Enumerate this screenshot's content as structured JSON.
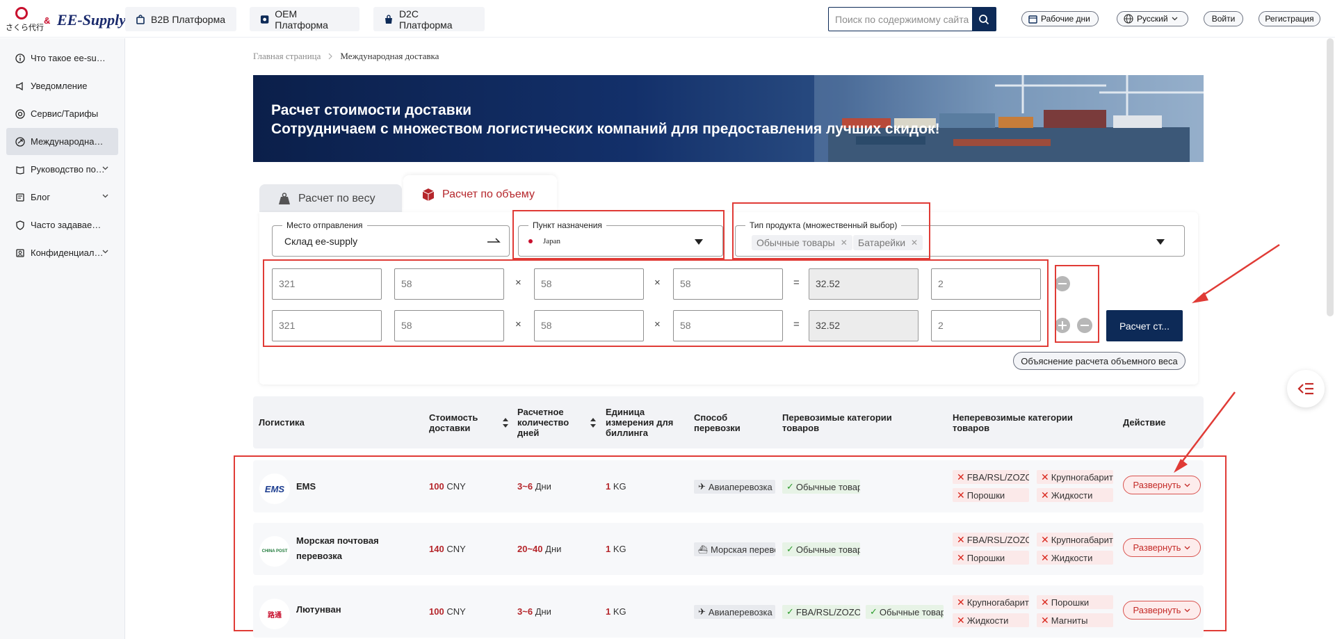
{
  "header": {
    "logo_jp": "さくら代行",
    "logo_amp": "&",
    "logo_name": "EE-Supply",
    "platforms": [
      "B2B Платформа",
      "OEM Платформа",
      "D2C Платформа"
    ],
    "search_placeholder": "Поиск по содержимому сайта",
    "workdays": "Рабочие дни",
    "language": "Русский",
    "login": "Войти",
    "register": "Регистрация"
  },
  "sidebar": {
    "items": [
      {
        "label": "Что такое ee-supply",
        "icon": "info-icon"
      },
      {
        "label": "Уведомление",
        "icon": "megaphone-icon"
      },
      {
        "label": "Сервис/Тарифы",
        "icon": "service-icon"
      },
      {
        "label": "Международная доставка",
        "icon": "globe-plane-icon"
      },
      {
        "label": "Руководство пользователя",
        "icon": "guide-icon"
      },
      {
        "label": "Блог",
        "icon": "blog-icon"
      },
      {
        "label": "Часто задаваемые вопросы",
        "icon": "shield-icon"
      },
      {
        "label": "Конфиденциальность",
        "icon": "privacy-icon"
      }
    ]
  },
  "breadcrumb": {
    "home": "Главная страница",
    "current": "Международная доставка"
  },
  "banner": {
    "title": "Расчет стоимости доставки",
    "subtitle": "Сотрудничаем с множеством логистических компаний для предоставления лучших скидок!"
  },
  "calc": {
    "tab_weight": "Расчет по весу",
    "tab_volume": "Расчет по объему",
    "origin_label": "Место отправления",
    "origin_value": "Склад ee-supply",
    "dest_label": "Пункт назначения",
    "dest_value": "Japan",
    "product_label": "Тип продукта (множественный выбор)",
    "product_tags": [
      "Обычные товары",
      "Батарейки"
    ],
    "rows": [
      {
        "weight": "321",
        "l": "58",
        "w": "58",
        "h": "58",
        "result": "32.52",
        "qty": "2"
      },
      {
        "weight": "321",
        "l": "58",
        "w": "58",
        "h": "58",
        "result": "32.52",
        "qty": "2"
      }
    ],
    "times": "×",
    "equals": "=",
    "calc_button": "Расчет ст...",
    "explain_button": "Объяснение расчета объемного веса"
  },
  "table": {
    "headers": {
      "logistics": "Логистика",
      "cost": "Стоимость доставки",
      "days": "Расчетное количество дней",
      "unit": "Единица измерения для биллинга",
      "method": "Способ перевозки",
      "allowed": "Перевозимые категории товаров",
      "forbidden": "Неперевозимые категории товаров",
      "action": "Действие"
    },
    "rows": [
      {
        "name": "EMS",
        "logo": "EMS",
        "cost": "100",
        "currency": "CNY",
        "days": "3~6",
        "days_unit": "Дни",
        "unit_val": "1",
        "unit": "KG",
        "method": "Авиаперевозка",
        "allowed": [
          "Обычные товары"
        ],
        "forbidden": [
          "FBA/RSL/ZOZO",
          "Крупногабаритные",
          "Порошки",
          "Жидкости"
        ],
        "action": "Развернуть"
      },
      {
        "name": "Морская почтовая перевозка",
        "logo": "CHINA POST",
        "cost": "140",
        "currency": "CNY",
        "days": "20~40",
        "days_unit": "Дни",
        "unit_val": "1",
        "unit": "KG",
        "method": "Морская перевозка",
        "allowed": [
          "Обычные товары"
        ],
        "forbidden": [
          "FBA/RSL/ZOZO",
          "Крупногабаритные",
          "Порошки",
          "Жидкости"
        ],
        "action": "Развернуть"
      },
      {
        "name": "Лютунван",
        "logo": "路通",
        "cost": "100",
        "currency": "CNY",
        "days": "3~6",
        "days_unit": "Дни",
        "unit_val": "1",
        "unit": "KG",
        "method": "Авиаперевозка",
        "allowed": [
          "FBA/RSL/ZOZO",
          "Обычные товары"
        ],
        "forbidden": [
          "Крупногабаритные",
          "Порошки",
          "Жидкости",
          "Магниты"
        ],
        "action": "Развернуть"
      }
    ]
  },
  "colors": {
    "navy": "#0d2a57",
    "accent_red": "#b5262b",
    "annotation": "#e03b36"
  }
}
